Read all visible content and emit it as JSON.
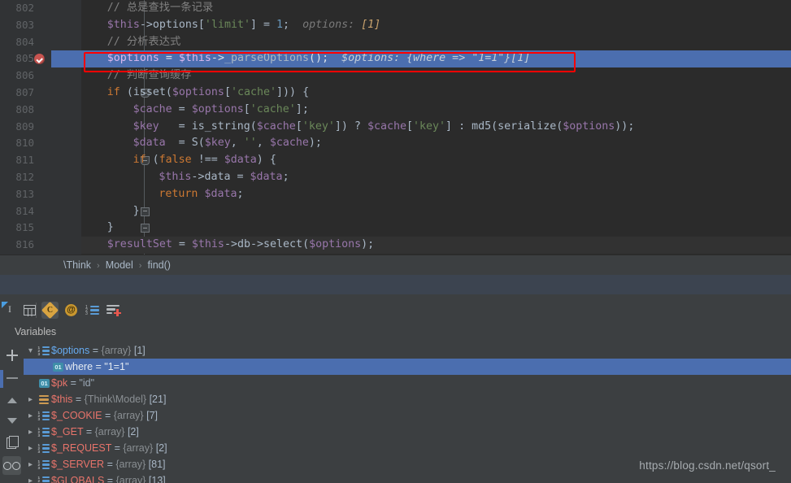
{
  "editor": {
    "breakpoint_line": 805,
    "selected_line": 805,
    "lines": [
      {
        "num": "802",
        "indent": 4,
        "text": "// 总是查找一条记录"
      },
      {
        "num": "803",
        "indent": 4,
        "text": "$this->options['limit'] = 1;",
        "hint": "options: [1]"
      },
      {
        "num": "804",
        "indent": 4,
        "text": "// 分析表达式"
      },
      {
        "num": "805",
        "indent": 4,
        "text": "$options = $this->_parseOptions();",
        "hint": "$options: {where => \"1=1\"}[1]"
      },
      {
        "num": "806",
        "indent": 4,
        "text": "// 判断查询缓存"
      },
      {
        "num": "807",
        "indent": 4,
        "text": "if (isset($options['cache'])) {"
      },
      {
        "num": "808",
        "indent": 8,
        "text": "$cache = $options['cache'];"
      },
      {
        "num": "809",
        "indent": 8,
        "text": "$key   = is_string($cache['key']) ? $cache['key'] : md5(serialize($options));"
      },
      {
        "num": "810",
        "indent": 8,
        "text": "$data  = S($key, '', $cache);"
      },
      {
        "num": "811",
        "indent": 8,
        "text": "if (false !== $data) {"
      },
      {
        "num": "812",
        "indent": 12,
        "text": "$this->data = $data;"
      },
      {
        "num": "813",
        "indent": 12,
        "text": "return $data;"
      },
      {
        "num": "814",
        "indent": 8,
        "text": "}"
      },
      {
        "num": "815",
        "indent": 4,
        "text": "}"
      },
      {
        "num": "816",
        "indent": 4,
        "text": "$resultSet = $this->db->select($options);"
      }
    ]
  },
  "breadcrumb": {
    "items": [
      "\\Think",
      "Model",
      "find()"
    ],
    "separator": "›"
  },
  "toolbar": {
    "cursor_icon": "cursor-select-icon",
    "buttons": [
      {
        "name": "table-view-button",
        "icon": "grid-icon",
        "label": "",
        "active": false
      },
      {
        "name": "inspect-button",
        "icon": "diamond-c-icon",
        "label": "C",
        "active": true
      },
      {
        "name": "evaluate-button",
        "icon": "at-circle-icon",
        "label": "@",
        "active": false
      },
      {
        "name": "numbered-list-button",
        "icon": "numbered-list-icon",
        "label": "",
        "active": false
      },
      {
        "name": "add-watch-button",
        "icon": "list-plus-icon",
        "label": "",
        "active": false
      }
    ]
  },
  "variables_panel": {
    "title": "Variables",
    "sidebar_buttons": [
      {
        "name": "add-button",
        "icon": "plus-icon"
      },
      {
        "name": "remove-button",
        "icon": "minus-icon"
      },
      {
        "name": "move-up-button",
        "icon": "arrow-up-icon"
      },
      {
        "name": "move-down-button",
        "icon": "arrow-down-icon"
      },
      {
        "name": "copy-button",
        "icon": "copy-icon"
      },
      {
        "name": "watches-button",
        "icon": "eyes-icon",
        "active": true
      }
    ],
    "rows": [
      {
        "twisty": "▾",
        "icon": "array-icon",
        "indent": 0,
        "name": "$options",
        "eq": " = ",
        "type": "{array}",
        "count": "[1]",
        "selected": false,
        "name_color": "blue"
      },
      {
        "twisty": "",
        "icon": "scalar-icon",
        "indent": 1,
        "name": "where",
        "eq": " = ",
        "type": "",
        "value": "\"1=1\"",
        "selected": true,
        "name_color": "plain"
      },
      {
        "twisty": "",
        "icon": "scalar-icon",
        "indent": 0,
        "name": "$pk",
        "eq": " = ",
        "type": "",
        "value": "\"id\"",
        "selected": false,
        "name_color": "red"
      },
      {
        "twisty": "▸",
        "icon": "object-icon",
        "indent": 0,
        "name": "$this",
        "eq": " = ",
        "type": "{Think\\Model}",
        "count": "[21]",
        "selected": false,
        "name_color": "red"
      },
      {
        "twisty": "▸",
        "icon": "array-icon",
        "indent": 0,
        "name": "$_COOKIE",
        "eq": " = ",
        "type": "{array}",
        "count": "[7]",
        "selected": false,
        "name_color": "red"
      },
      {
        "twisty": "▸",
        "icon": "array-icon",
        "indent": 0,
        "name": "$_GET",
        "eq": " = ",
        "type": "{array}",
        "count": "[2]",
        "selected": false,
        "name_color": "red"
      },
      {
        "twisty": "▸",
        "icon": "array-icon",
        "indent": 0,
        "name": "$_REQUEST",
        "eq": " = ",
        "type": "{array}",
        "count": "[2]",
        "selected": false,
        "name_color": "red"
      },
      {
        "twisty": "▸",
        "icon": "array-icon",
        "indent": 0,
        "name": "$_SERVER",
        "eq": " = ",
        "type": "{array}",
        "count": "[81]",
        "selected": false,
        "name_color": "red"
      },
      {
        "twisty": "▸",
        "icon": "array-icon",
        "indent": 0,
        "name": "$GLOBALS",
        "eq": " = ",
        "type": "{array}",
        "count": "[13]",
        "selected": false,
        "name_color": "red"
      }
    ]
  },
  "watermark": "https://blog.csdn.net/qsort_",
  "colors": {
    "editor_bg": "#2b2b2b",
    "panel_bg": "#3c3f41",
    "gutter_bg": "#313335",
    "selection_blue": "#4b6eaf",
    "annotation_red": "#ff0000",
    "keyword": "#cc7832",
    "string": "#6a8759",
    "variable": "#9876aa",
    "comment": "#808080",
    "number": "#6897bb"
  }
}
